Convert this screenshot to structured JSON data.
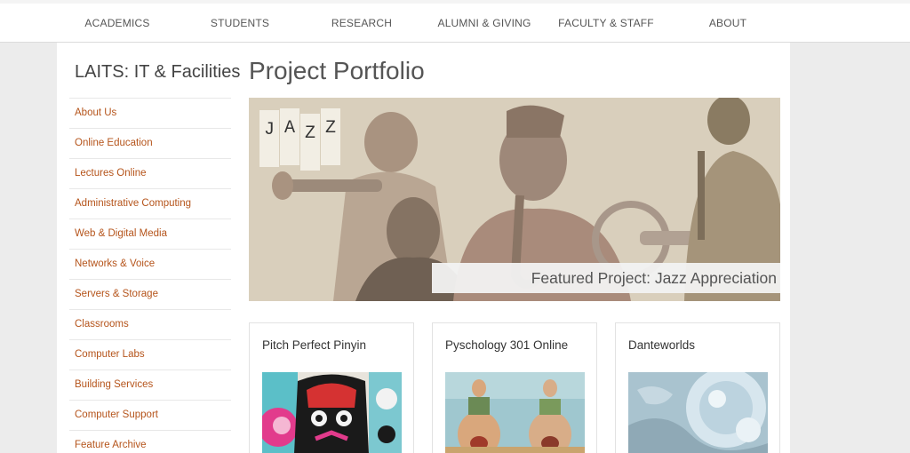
{
  "top_nav": {
    "items": [
      "ACADEMICS",
      "STUDENTS",
      "RESEARCH",
      "ALUMNI & GIVING",
      "FACULTY & STAFF",
      "ABOUT"
    ]
  },
  "sidebar": {
    "title": "LAITS: IT & Facilities",
    "items": [
      "About Us",
      "Online Education",
      "Lectures Online",
      "Administrative Computing",
      "Web & Digital Media",
      "Networks & Voice",
      "Servers & Storage",
      "Classrooms",
      "Computer Labs",
      "Building Services",
      "Computer Support",
      "Feature Archive"
    ]
  },
  "main": {
    "title": "Project Portfolio",
    "featured": {
      "logo_letters": [
        "J",
        "A",
        "Z",
        "Z"
      ],
      "caption": "Featured Project: Jazz Appreciation"
    },
    "cards": [
      {
        "title": "Pitch Perfect Pinyin"
      },
      {
        "title": "Pyschology 301 Online"
      },
      {
        "title": "Danteworlds"
      }
    ]
  },
  "colors": {
    "link": "#b5541b",
    "banner_bg": "#d9cfbc"
  }
}
